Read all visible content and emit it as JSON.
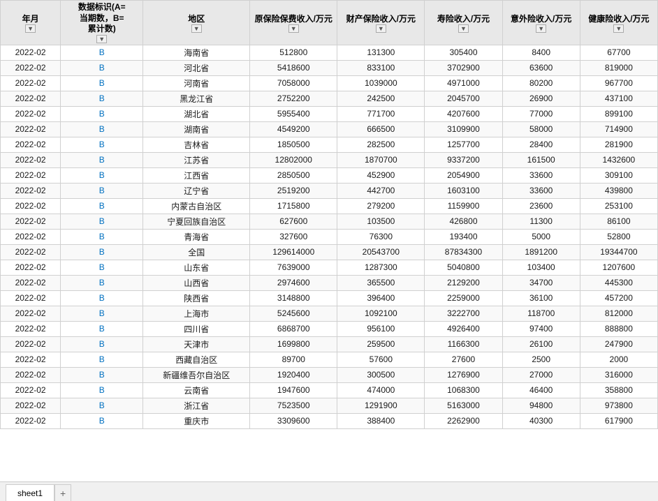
{
  "headers": {
    "col1": "年月",
    "col2_line1": "数据标识(A=",
    "col2_line2": "当期数，B=",
    "col2_line3": "累计数)",
    "col3": "地区",
    "col4": "原保险保费收入/万元",
    "col5": "财产保险收入/万元",
    "col6": "寿险收入/万元",
    "col7": "意外险收入/万元",
    "col8": "健康险收入/万元"
  },
  "tabs": [
    {
      "label": "sheet1"
    }
  ],
  "tab_add_label": "+",
  "rows": [
    {
      "date": "2022-02",
      "marker": "B",
      "region": "海南省",
      "premium": "512800",
      "property": "131300",
      "life": "305400",
      "accident": "8400",
      "health": "67700"
    },
    {
      "date": "2022-02",
      "marker": "B",
      "region": "河北省",
      "premium": "5418600",
      "property": "833100",
      "life": "3702900",
      "accident": "63600",
      "health": "819000"
    },
    {
      "date": "2022-02",
      "marker": "B",
      "region": "河南省",
      "premium": "7058000",
      "property": "1039000",
      "life": "4971000",
      "accident": "80200",
      "health": "967700"
    },
    {
      "date": "2022-02",
      "marker": "B",
      "region": "黑龙江省",
      "premium": "2752200",
      "property": "242500",
      "life": "2045700",
      "accident": "26900",
      "health": "437100"
    },
    {
      "date": "2022-02",
      "marker": "B",
      "region": "湖北省",
      "premium": "5955400",
      "property": "771700",
      "life": "4207600",
      "accident": "77000",
      "health": "899100"
    },
    {
      "date": "2022-02",
      "marker": "B",
      "region": "湖南省",
      "premium": "4549200",
      "property": "666500",
      "life": "3109900",
      "accident": "58000",
      "health": "714900"
    },
    {
      "date": "2022-02",
      "marker": "B",
      "region": "吉林省",
      "premium": "1850500",
      "property": "282500",
      "life": "1257700",
      "accident": "28400",
      "health": "281900"
    },
    {
      "date": "2022-02",
      "marker": "B",
      "region": "江苏省",
      "premium": "12802000",
      "property": "1870700",
      "life": "9337200",
      "accident": "161500",
      "health": "1432600"
    },
    {
      "date": "2022-02",
      "marker": "B",
      "region": "江西省",
      "premium": "2850500",
      "property": "452900",
      "life": "2054900",
      "accident": "33600",
      "health": "309100"
    },
    {
      "date": "2022-02",
      "marker": "B",
      "region": "辽宁省",
      "premium": "2519200",
      "property": "442700",
      "life": "1603100",
      "accident": "33600",
      "health": "439800"
    },
    {
      "date": "2022-02",
      "marker": "B",
      "region": "内蒙古自治区",
      "premium": "1715800",
      "property": "279200",
      "life": "1159900",
      "accident": "23600",
      "health": "253100"
    },
    {
      "date": "2022-02",
      "marker": "B",
      "region": "宁夏回族自治区",
      "premium": "627600",
      "property": "103500",
      "life": "426800",
      "accident": "11300",
      "health": "86100"
    },
    {
      "date": "2022-02",
      "marker": "B",
      "region": "青海省",
      "premium": "327600",
      "property": "76300",
      "life": "193400",
      "accident": "5000",
      "health": "52800"
    },
    {
      "date": "2022-02",
      "marker": "B",
      "region": "全国",
      "premium": "129614000",
      "property": "20543700",
      "life": "87834300",
      "accident": "1891200",
      "health": "19344700"
    },
    {
      "date": "2022-02",
      "marker": "B",
      "region": "山东省",
      "premium": "7639000",
      "property": "1287300",
      "life": "5040800",
      "accident": "103400",
      "health": "1207600"
    },
    {
      "date": "2022-02",
      "marker": "B",
      "region": "山西省",
      "premium": "2974600",
      "property": "365500",
      "life": "2129200",
      "accident": "34700",
      "health": "445300"
    },
    {
      "date": "2022-02",
      "marker": "B",
      "region": "陕西省",
      "premium": "3148800",
      "property": "396400",
      "life": "2259000",
      "accident": "36100",
      "health": "457200"
    },
    {
      "date": "2022-02",
      "marker": "B",
      "region": "上海市",
      "premium": "5245600",
      "property": "1092100",
      "life": "3222700",
      "accident": "118700",
      "health": "812000"
    },
    {
      "date": "2022-02",
      "marker": "B",
      "region": "四川省",
      "premium": "6868700",
      "property": "956100",
      "life": "4926400",
      "accident": "97400",
      "health": "888800"
    },
    {
      "date": "2022-02",
      "marker": "B",
      "region": "天津市",
      "premium": "1699800",
      "property": "259500",
      "life": "1166300",
      "accident": "26100",
      "health": "247900"
    },
    {
      "date": "2022-02",
      "marker": "B",
      "region": "西藏自治区",
      "premium": "89700",
      "property": "57600",
      "life": "27600",
      "accident": "2500",
      "health": "2000"
    },
    {
      "date": "2022-02",
      "marker": "B",
      "region": "新疆维吾尔自治区",
      "premium": "1920400",
      "property": "300500",
      "life": "1276900",
      "accident": "27000",
      "health": "316000"
    },
    {
      "date": "2022-02",
      "marker": "B",
      "region": "云南省",
      "premium": "1947600",
      "property": "474000",
      "life": "1068300",
      "accident": "46400",
      "health": "358800"
    },
    {
      "date": "2022-02",
      "marker": "B",
      "region": "浙江省",
      "premium": "7523500",
      "property": "1291900",
      "life": "5163000",
      "accident": "94800",
      "health": "973800"
    },
    {
      "date": "2022-02",
      "marker": "B",
      "region": "重庆市",
      "premium": "3309600",
      "property": "388400",
      "life": "2262900",
      "accident": "40300",
      "health": "617900"
    }
  ]
}
